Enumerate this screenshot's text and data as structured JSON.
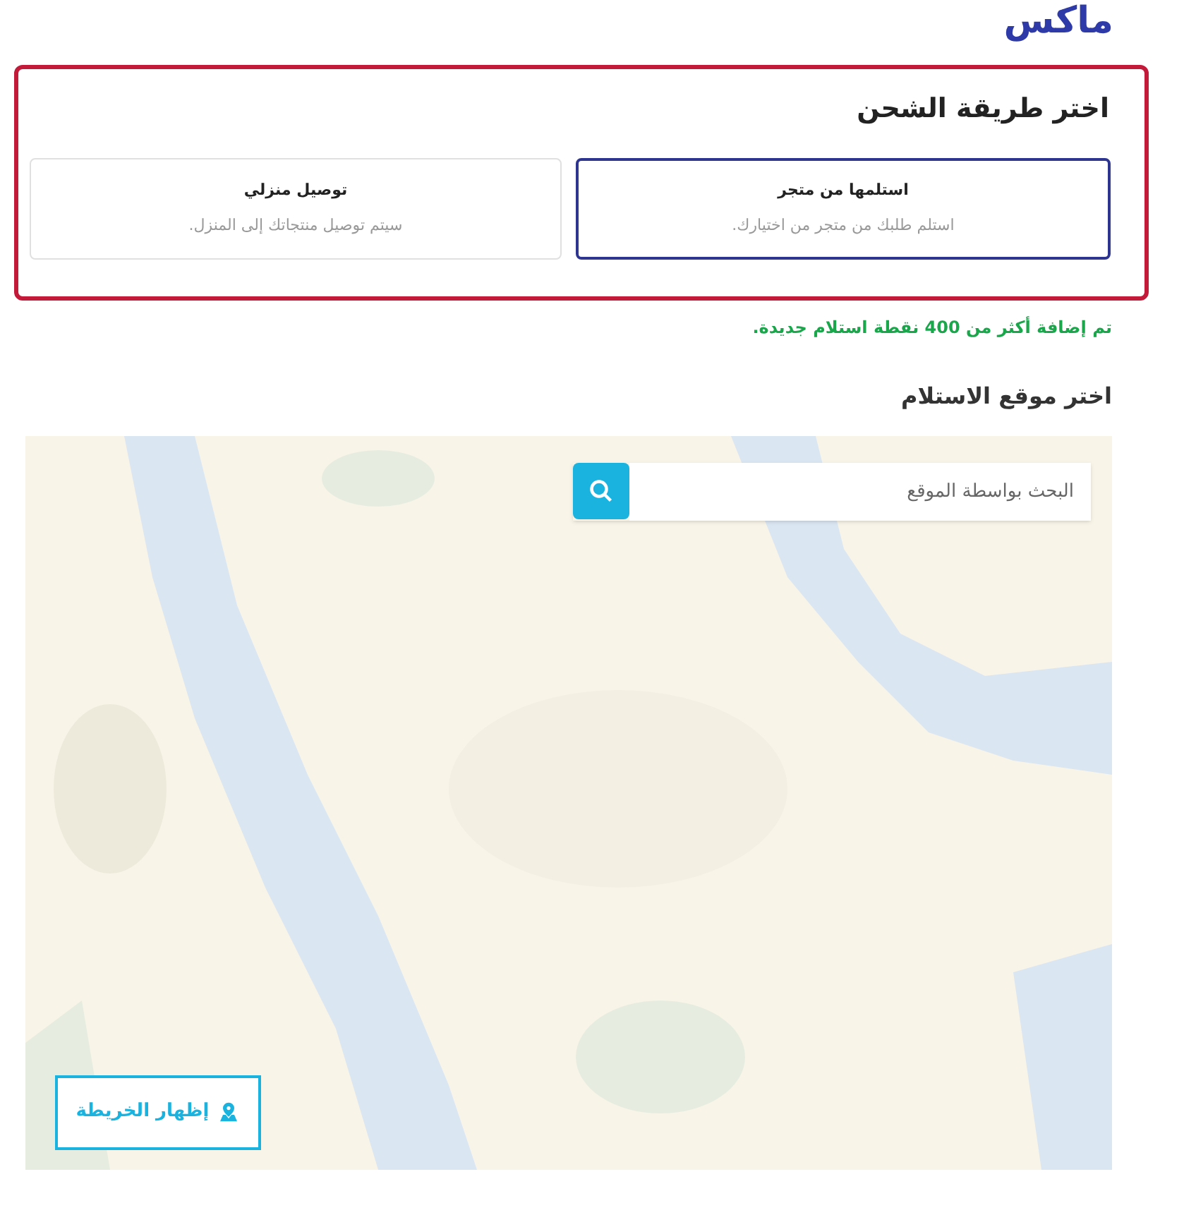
{
  "logo": {
    "text": "ماكس"
  },
  "shipping": {
    "title": "اختر طريقة الشحن",
    "options": [
      {
        "title": "استلمها من متجر",
        "description": "استلم طلبك من متجر من اختيارك.",
        "selected": true
      },
      {
        "title": "توصيل منزلي",
        "description": "سيتم توصيل منتجاتك إلى المنزل.",
        "selected": false
      }
    ]
  },
  "notice": "تم إضافة أكثر من 400 نقطة استلام جديدة.",
  "pickup": {
    "title": "اختر موقع الاستلام",
    "search": {
      "placeholder": "البحث بواسطة الموقع"
    },
    "show_map_button": "إظهار الخريطة"
  }
}
